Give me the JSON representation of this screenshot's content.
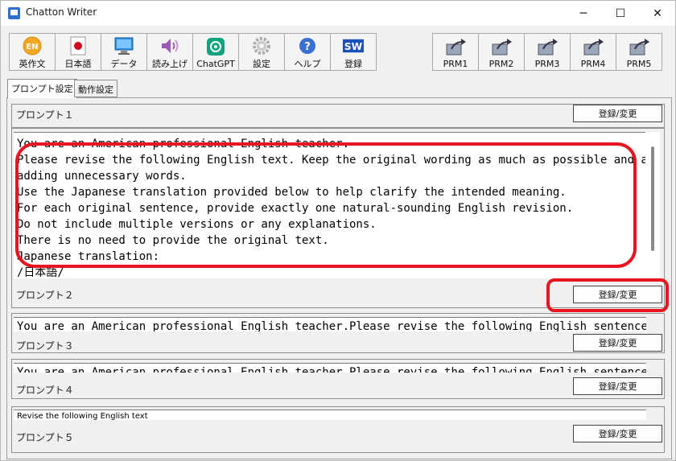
{
  "window": {
    "title": "Chatton Writer",
    "controls": {
      "minimize": "─",
      "maximize": "☐",
      "close": "✕"
    }
  },
  "toolbar": {
    "left": [
      {
        "label": "英作文",
        "icon": "en-circle-icon"
      },
      {
        "label": "日本語",
        "icon": "japan-flag-icon"
      },
      {
        "label": "データ",
        "icon": "monitor-icon"
      },
      {
        "label": "読み上げ",
        "icon": "speaker-icon"
      },
      {
        "label": "ChatGPT",
        "icon": "chatgpt-icon"
      },
      {
        "label": "設定",
        "icon": "gear-icon"
      },
      {
        "label": "ヘルプ",
        "icon": "help-icon"
      },
      {
        "label": "登録",
        "icon": "sw-badge-icon",
        "badge": "SW"
      }
    ],
    "right": [
      {
        "label": "PRM1",
        "icon": "share-icon"
      },
      {
        "label": "PRM2",
        "icon": "share-icon"
      },
      {
        "label": "PRM3",
        "icon": "share-icon"
      },
      {
        "label": "PRM4",
        "icon": "share-icon"
      },
      {
        "label": "PRM5",
        "icon": "share-icon"
      }
    ]
  },
  "tabs": [
    {
      "label": "プロンプト設定",
      "active": true
    },
    {
      "label": "動作設定",
      "active": false
    }
  ],
  "prompts": [
    {
      "label": "プロンプト１",
      "button": "登録/変更",
      "lines": [
        "You are an American professional English teacher.",
        "Please revise the following English text. Keep the original wording as much as possible and avoid",
        "adding unnecessary words.",
        "Use the Japanese translation provided below to help clarify the intended meaning.",
        "For each original sentence, provide exactly one natural-sounding English revision.",
        "Do not include multiple versions or any explanations.",
        "There is no need to provide the original text.",
        "Japanese translation:",
        "/日本語/"
      ]
    },
    {
      "label": "プロンプト２",
      "button": "登録/変更",
      "text": "You are an American professional English teacher.Please revise the following English sentences to"
    },
    {
      "label": "プロンプト３",
      "button": "登録/変更",
      "text": "You are an American professional English teacher.Please revise the following English sentences. For"
    },
    {
      "label": "プロンプト４",
      "button": "登録/変更",
      "text": "Revise the following English text"
    },
    {
      "label": "プロンプト５",
      "button": "登録/変更"
    }
  ],
  "colors": {
    "highlight": "#e8141e",
    "sw_badge": "#1c52b8"
  }
}
